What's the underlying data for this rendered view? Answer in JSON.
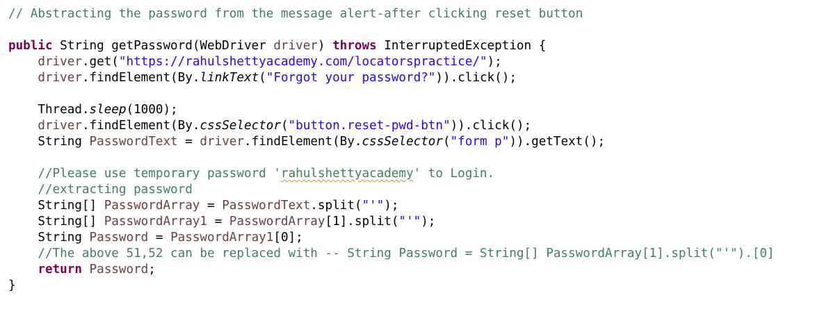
{
  "editor": {
    "lines": [
      [
        {
          "t": "// Abstracting the password from the message alert-after clicking reset button",
          "c": "comment"
        }
      ],
      [],
      [
        {
          "t": "public",
          "c": "keyword"
        },
        {
          "t": " String getPassword(WebDriver ",
          "c": "plain"
        },
        {
          "t": "driver",
          "c": "variable"
        },
        {
          "t": ") ",
          "c": "plain"
        },
        {
          "t": "throws",
          "c": "keyword"
        },
        {
          "t": " InterruptedException {",
          "c": "plain"
        }
      ],
      [
        {
          "t": "    ",
          "c": "plain"
        },
        {
          "t": "driver",
          "c": "variable"
        },
        {
          "t": ".get(",
          "c": "plain"
        },
        {
          "t": "\"https://rahulshettyacademy.com/locatorspractice/\"",
          "c": "string"
        },
        {
          "t": ");",
          "c": "plain"
        }
      ],
      [
        {
          "t": "    ",
          "c": "plain"
        },
        {
          "t": "driver",
          "c": "variable"
        },
        {
          "t": ".findElement(By.",
          "c": "plain"
        },
        {
          "t": "linkText",
          "c": "static"
        },
        {
          "t": "(",
          "c": "plain"
        },
        {
          "t": "\"Forgot your password?\"",
          "c": "string"
        },
        {
          "t": ")).click();",
          "c": "plain"
        }
      ],
      [],
      [
        {
          "t": "    Thread.",
          "c": "plain"
        },
        {
          "t": "sleep",
          "c": "static"
        },
        {
          "t": "(1000);",
          "c": "plain"
        }
      ],
      [
        {
          "t": "    ",
          "c": "plain"
        },
        {
          "t": "driver",
          "c": "variable"
        },
        {
          "t": ".findElement(By.",
          "c": "plain"
        },
        {
          "t": "cssSelector",
          "c": "static"
        },
        {
          "t": "(",
          "c": "plain"
        },
        {
          "t": "\"button.reset-pwd-btn\"",
          "c": "string"
        },
        {
          "t": ")).click();",
          "c": "plain"
        }
      ],
      [
        {
          "t": "    String ",
          "c": "plain"
        },
        {
          "t": "PasswordText",
          "c": "variable"
        },
        {
          "t": " = ",
          "c": "plain"
        },
        {
          "t": "driver",
          "c": "variable"
        },
        {
          "t": ".findElement(By.",
          "c": "plain"
        },
        {
          "t": "cssSelector",
          "c": "static"
        },
        {
          "t": "(",
          "c": "plain"
        },
        {
          "t": "\"form p\"",
          "c": "string"
        },
        {
          "t": ")).getText();",
          "c": "plain"
        }
      ],
      [],
      [
        {
          "t": "    //Please use temporary password '",
          "c": "comment"
        },
        {
          "t": "rahulshettyacademy",
          "c": "comment-spell"
        },
        {
          "t": "' to Login.",
          "c": "comment"
        }
      ],
      [
        {
          "t": "    //extracting password",
          "c": "comment"
        }
      ],
      [
        {
          "t": "    String[] ",
          "c": "plain"
        },
        {
          "t": "PasswordArray",
          "c": "variable"
        },
        {
          "t": " = ",
          "c": "plain"
        },
        {
          "t": "PasswordText",
          "c": "variable"
        },
        {
          "t": ".split(",
          "c": "plain"
        },
        {
          "t": "\"'\"",
          "c": "string"
        },
        {
          "t": ");",
          "c": "plain"
        }
      ],
      [
        {
          "t": "    String[] ",
          "c": "plain"
        },
        {
          "t": "PasswordArray1",
          "c": "variable"
        },
        {
          "t": " = ",
          "c": "plain"
        },
        {
          "t": "PasswordArray",
          "c": "variable"
        },
        {
          "t": "[1].split(",
          "c": "plain"
        },
        {
          "t": "\"'\"",
          "c": "string"
        },
        {
          "t": ");",
          "c": "plain"
        }
      ],
      [
        {
          "t": "    String ",
          "c": "plain"
        },
        {
          "t": "Password",
          "c": "variable"
        },
        {
          "t": " = ",
          "c": "plain"
        },
        {
          "t": "PasswordArray1",
          "c": "variable"
        },
        {
          "t": "[0];",
          "c": "plain"
        }
      ],
      [
        {
          "t": "    //The above 51,52 can be replaced with -- String Password = String[] PasswordArray[1].split(\"'\").[0]",
          "c": "comment"
        }
      ],
      [
        {
          "t": "    ",
          "c": "plain"
        },
        {
          "t": "return",
          "c": "keyword"
        },
        {
          "t": " ",
          "c": "plain"
        },
        {
          "t": "Password",
          "c": "variable"
        },
        {
          "t": ";",
          "c": "plain"
        }
      ],
      [
        {
          "t": "}",
          "c": "plain"
        }
      ]
    ],
    "edge_marks": [
      {
        "line": 3,
        "text": "//"
      },
      {
        "line": 8,
        "text": "//"
      },
      {
        "line": 10,
        "text": "//"
      },
      {
        "line": 12,
        "text": "//"
      },
      {
        "line": 13,
        "text": "//"
      }
    ]
  },
  "colors": {
    "comment": "#3f7f5f",
    "keyword": "#7f0055",
    "string": "#2a00ff",
    "variable": "#6a3e3e",
    "plain": "#000000",
    "background": "#ffffff"
  }
}
